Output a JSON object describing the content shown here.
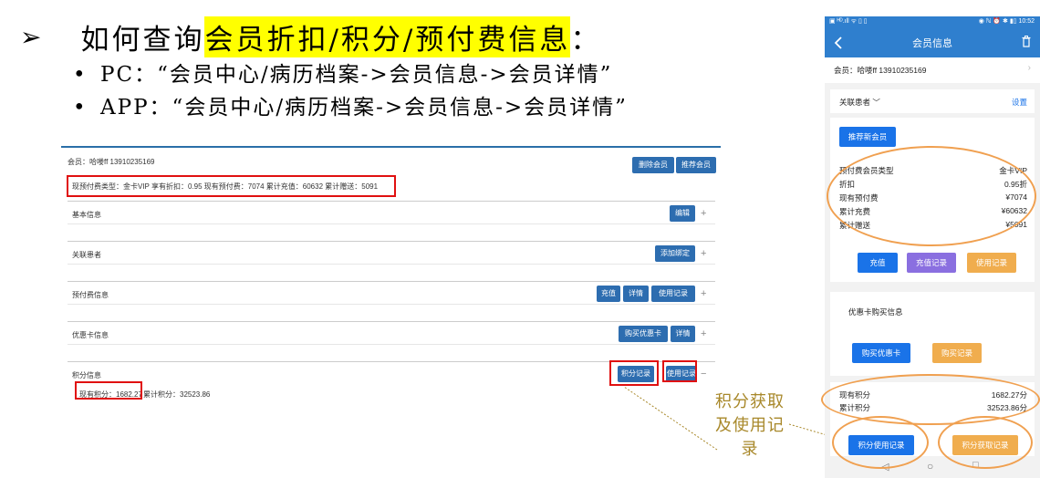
{
  "slide": {
    "arrow": "➢",
    "headline_prefix": "如何查询",
    "headline_highlight": "会员折扣/积分/预付费信息",
    "headline_suffix": "：",
    "bullets": [
      {
        "marker": "•",
        "text": "PC：“会员中心/病历档案->会员信息->会员详情”"
      },
      {
        "marker": "•",
        "text": "APP：“会员中心/病历档案->会员信息->会员详情”"
      }
    ],
    "annotation": "积分获取及使用记录"
  },
  "pc": {
    "member_line": "会员：哈喽ff 13910235169",
    "delete_button": "删除会员",
    "recommend_button": "推荐会员",
    "prepay_summary": "现预付费类型：金卡VIP 享有折扣：0.95 现有预付费：7074 累计充值：60632 累计赠送：5091",
    "sections": [
      {
        "label": "基本信息",
        "buttons": [
          "编辑"
        ],
        "toggle": "+"
      },
      {
        "label": "关联患者",
        "buttons": [
          "添加绑定"
        ],
        "toggle": "+"
      },
      {
        "label": "预付费信息",
        "buttons": [
          "充值",
          "详情",
          "使用记录"
        ],
        "toggle": "+"
      },
      {
        "label": "优惠卡信息",
        "buttons": [
          "购买优惠卡",
          "详情"
        ],
        "toggle": "+"
      },
      {
        "label": "积分信息",
        "buttons": [
          "积分记录",
          "使用记录"
        ],
        "toggle": "−"
      }
    ],
    "points_current": "现有积分：1682.27",
    "points_total": "累计积分：32523.86"
  },
  "phone": {
    "status_left": "▣ ᴴᴰ.ıll ᯤ ▯ ▯",
    "status_right": "◉ ℕ ⏰ ✱ ▮▯ 10:52",
    "title": "会员信息",
    "member_line": "会员：哈喽ff 13910235169",
    "related_label": "关联患者",
    "settings": "设置",
    "recommend_button": "推荐新会员",
    "prepay_rows": [
      {
        "k": "预付费会员类型",
        "v": "金卡VIP"
      },
      {
        "k": "折扣",
        "v": "0.95折"
      },
      {
        "k": "现有预付费",
        "v": "¥7074"
      },
      {
        "k": "累计充费",
        "v": "¥60632"
      },
      {
        "k": "累计赠送",
        "v": "¥5091"
      }
    ],
    "recharge_button": "充值",
    "recharge_record_button": "充值记录",
    "use_record_button": "使用记录",
    "coupon_title": "优惠卡购买信息",
    "buy_coupon_button": "购买优惠卡",
    "buy_record_button": "购买记录",
    "points_rows": [
      {
        "k": "现有积分",
        "v": "1682.27分"
      },
      {
        "k": "累计积分",
        "v": "32523.86分"
      }
    ],
    "points_use_button": "积分使用记录",
    "points_get_button": "积分获取记录",
    "nav_back": "◁",
    "nav_home": "○",
    "nav_recent": "□"
  },
  "colors": {
    "highlight": "#ffff00",
    "pc_button": "#2d6db0",
    "phone_blue": "#1a73e8",
    "phone_purple": "#8a6fe0",
    "phone_orange": "#f0ad4e",
    "red_box": "#e01010",
    "orange_circle": "#f0a050"
  }
}
